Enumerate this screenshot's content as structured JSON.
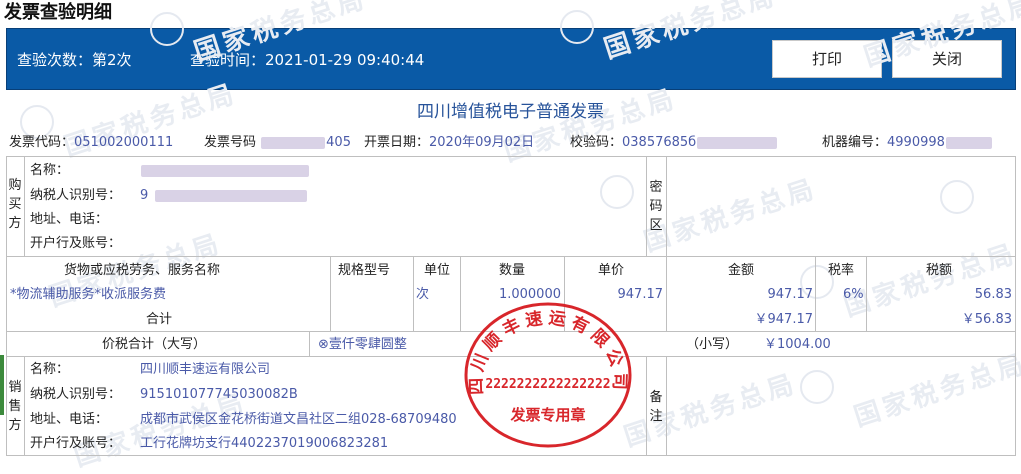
{
  "page": {
    "title": "发票查验明细"
  },
  "header": {
    "check_count": "查验次数：第2次",
    "check_time": "查验时间：2021-01-29 09:40:44",
    "print_button": "打印",
    "close_button": "关闭"
  },
  "invoice": {
    "title": "四川增值税电子普通发票",
    "code_label": "发票代码：",
    "code": "051002000111",
    "number_label": "发票号码",
    "number_suffix": "405",
    "date_label": "开票日期：",
    "date": "2020年09月02日",
    "check_code_label": "校验码：",
    "check_code": "03857685б",
    "machine_label": "机器编号：",
    "machine_no": "4990998"
  },
  "buyer": {
    "section_label": [
      "购",
      "买",
      "方"
    ],
    "name_label": "名称：",
    "tax_id_label": "纳税人识别号：",
    "tax_id_prefix": "9",
    "address_label": "地址、电话：",
    "bank_label": "开户行及账号："
  },
  "password_area": {
    "label": [
      "密",
      "码",
      "区"
    ]
  },
  "items": {
    "headers": {
      "name": "货物或应税劳务、服务名称",
      "spec": "规格型号",
      "unit": "单位",
      "qty": "数量",
      "price": "单价",
      "amount": "金额",
      "rate": "税率",
      "tax": "税额"
    },
    "rows": [
      {
        "name": "*物流辅助服务*收派服务费",
        "unit": "次",
        "qty": "1.000000",
        "price": "947.17",
        "amount": "947.17",
        "rate": "6%",
        "tax": "56.83"
      }
    ],
    "subtotal_label": "合计",
    "subtotal_amount": "￥947.17",
    "subtotal_tax": "￥56.83"
  },
  "total": {
    "label": "价税合计（大写）",
    "in_words": "⊗壹仟零肆圆整",
    "small_label": "（小写）",
    "small_value": "￥1004.00"
  },
  "seller": {
    "section_label": [
      "销",
      "售",
      "方"
    ],
    "name_label": "名称：",
    "name": "四川顺丰速运有限公司",
    "tax_id_label": "纳税人识别号：",
    "tax_id": "915101077745030082B",
    "address_label": "地址、电话：",
    "address": "成都市武侯区金花桥街道文昌社区二组028-68709480",
    "bank_label": "开户行及账号：",
    "bank": "工行花牌坊支行4402237019006823281"
  },
  "remarks": {
    "label": [
      "备",
      "注"
    ]
  },
  "stamp": {
    "company_text": "四川顺丰速运有限公司",
    "number": "2222222222222222",
    "footer": "发票专用章"
  },
  "watermark": {
    "text": "国家税务总局"
  },
  "colors": {
    "header_bg": "#0a5aa6",
    "title_blue": "#27539a",
    "value_blue": "#4a5aa8",
    "stamp_red": "#d8262b"
  }
}
